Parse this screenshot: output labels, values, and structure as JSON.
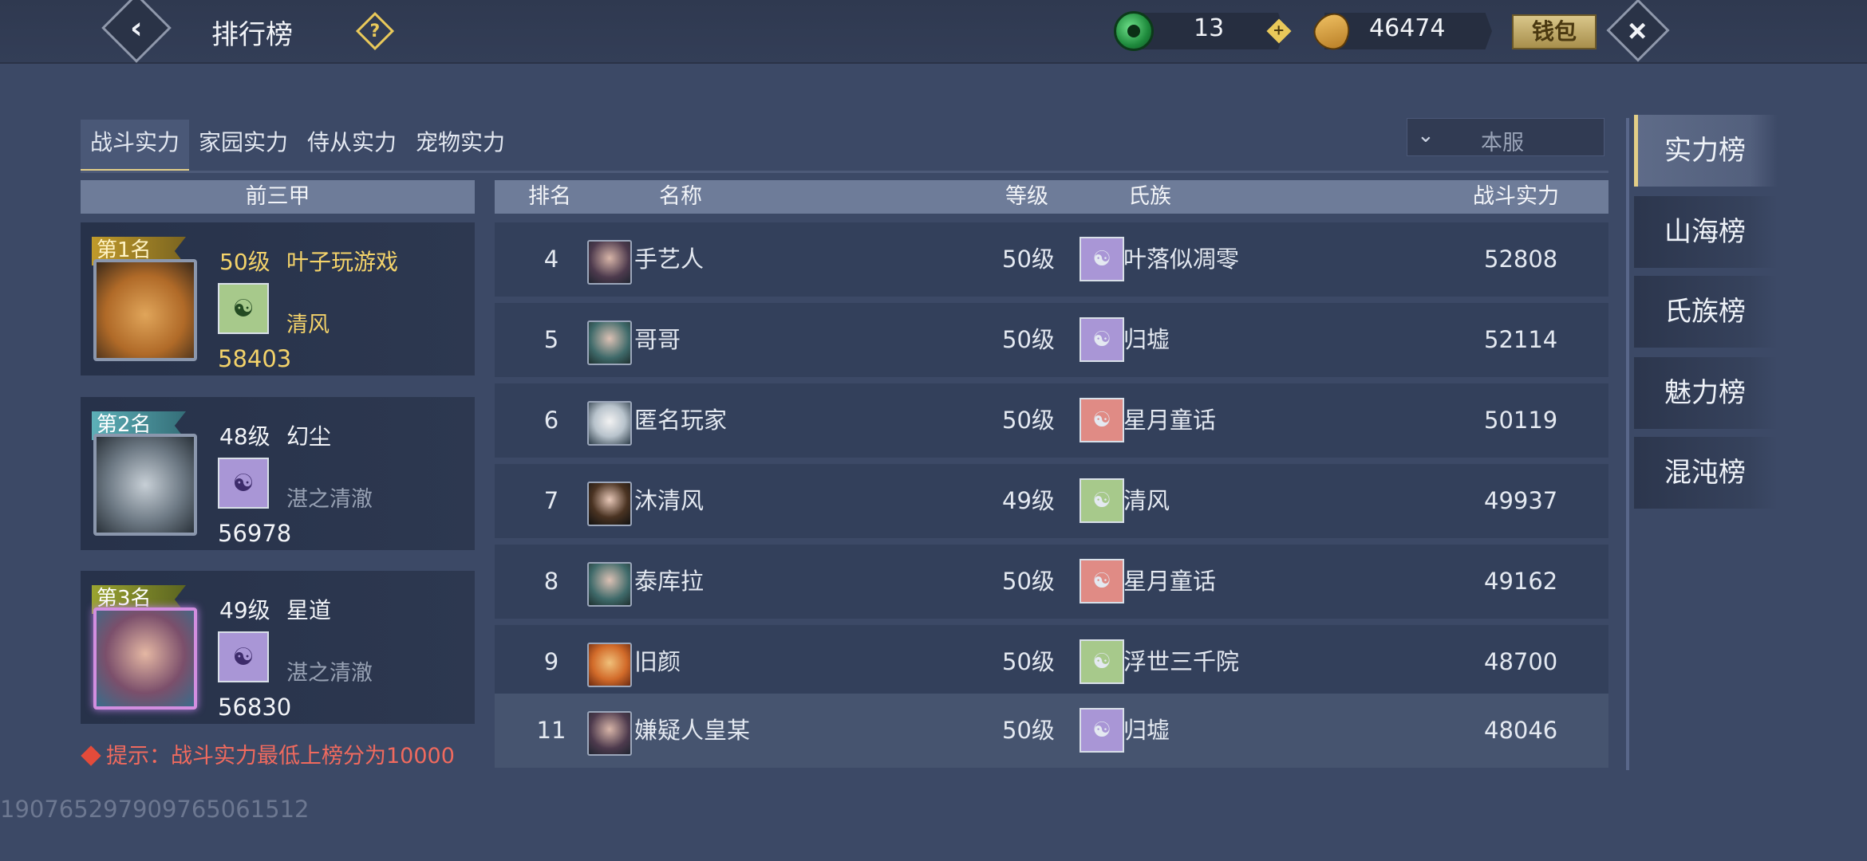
{
  "header": {
    "title": "排行榜",
    "help_icon": "question-diamond-icon",
    "jade_amount": "13",
    "ingot_amount": "46474",
    "wallet_label": "钱包"
  },
  "category_tabs": [
    "战斗实力",
    "家园实力",
    "侍从实力",
    "宠物实力"
  ],
  "active_category": "战斗实力",
  "server_select": {
    "value": "本服"
  },
  "top3": {
    "header": "前三甲",
    "cards": [
      {
        "rank_label": "第1名",
        "level": "50级",
        "name": "叶子玩游戏",
        "clan": "清风",
        "power": "58403",
        "emblem": "green"
      },
      {
        "rank_label": "第2名",
        "level": "48级",
        "name": "幻尘",
        "clan": "湛之清澈",
        "power": "56978",
        "emblem": "purple"
      },
      {
        "rank_label": "第3名",
        "level": "49级",
        "name": "星道",
        "clan": "湛之清澈",
        "power": "56830",
        "emblem": "purple"
      }
    ],
    "tip": "提示：战斗实力最低上榜分为10000"
  },
  "uid": "19076529790976506151​2",
  "table": {
    "headers": {
      "rank": "排名",
      "name": "名称",
      "level": "等级",
      "clan": "氏族",
      "power": "战斗实力"
    },
    "rows": [
      {
        "rank": "4",
        "name": "手艺人",
        "level": "50级",
        "clan": "叶落似凋零",
        "power": "52808"
      },
      {
        "rank": "5",
        "name": "哥哥",
        "level": "50级",
        "clan": "归墟",
        "power": "52114"
      },
      {
        "rank": "6",
        "name": "匿名玩家",
        "level": "50级",
        "clan": "星月童话",
        "power": "50119"
      },
      {
        "rank": "7",
        "name": "沐清风",
        "level": "49级",
        "clan": "清风",
        "power": "49937"
      },
      {
        "rank": "8",
        "name": "泰库拉",
        "level": "50级",
        "clan": "星月童话",
        "power": "49162"
      },
      {
        "rank": "9",
        "name": "旧颜",
        "level": "50级",
        "clan": "浮世三千院",
        "power": "48700"
      },
      {
        "rank": "11",
        "name": "嫌疑人皇某",
        "level": "50级",
        "clan": "归墟",
        "power": "48046"
      }
    ]
  },
  "side_tabs": [
    "实力榜",
    "山海榜",
    "氏族榜",
    "魅力榜",
    "混沌榜"
  ],
  "active_side_tab": "实力榜",
  "colors": {
    "gold_text": "#f4d36a",
    "accent": "#e2ce87",
    "tip_red": "#f06a5e",
    "bg": "#3c4966"
  }
}
